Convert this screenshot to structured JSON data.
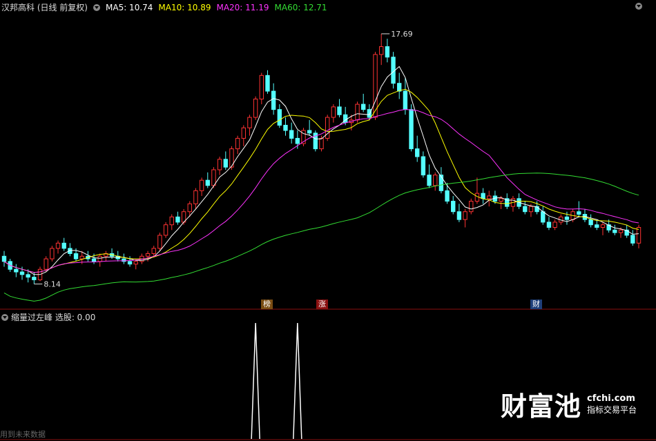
{
  "header": {
    "stock": "汉邦高科 (日线 前复权)",
    "ma5": "MA5: 10.74",
    "ma10": "MA10: 10.89",
    "ma20": "MA20: 11.19",
    "ma60": "MA60: 12.71",
    "colors": {
      "ma5": "#ffffff",
      "ma10": "#ffff00",
      "ma20": "#ff33ff",
      "ma60": "#33dd33",
      "up": "#ff3333",
      "down": "#54ffff"
    }
  },
  "sub_panel": {
    "title": "缩量过左峰 选股: 0.00"
  },
  "tags": [
    "榜",
    "涨",
    "财"
  ],
  "watermark": {
    "brand": "财富池",
    "url": "cfchi.com",
    "slogan": "指标交易平台"
  },
  "footer": "用到未来数据",
  "chart_data": {
    "type": "candlestick",
    "high_label": "17.69",
    "low_label": "8.14",
    "candles": [
      [
        9.2,
        9.4,
        8.8,
        9.0
      ],
      [
        9.0,
        9.1,
        8.6,
        8.7
      ],
      [
        8.7,
        8.9,
        8.4,
        8.6
      ],
      [
        8.6,
        8.8,
        8.3,
        8.5
      ],
      [
        8.5,
        8.7,
        8.2,
        8.4
      ],
      [
        8.4,
        8.6,
        8.14,
        8.3
      ],
      [
        8.3,
        8.8,
        8.25,
        8.7
      ],
      [
        8.7,
        9.2,
        8.6,
        9.1
      ],
      [
        9.1,
        9.6,
        9.0,
        9.5
      ],
      [
        9.5,
        9.8,
        9.3,
        9.7
      ],
      [
        9.7,
        9.9,
        9.4,
        9.5
      ],
      [
        9.5,
        9.7,
        9.2,
        9.3
      ],
      [
        9.3,
        9.5,
        9.0,
        9.1
      ],
      [
        9.1,
        9.4,
        8.9,
        9.2
      ],
      [
        9.2,
        9.4,
        9.0,
        9.1
      ],
      [
        9.1,
        9.3,
        8.9,
        9.0
      ],
      [
        9.0,
        9.3,
        8.8,
        9.2
      ],
      [
        9.2,
        9.4,
        9.0,
        9.3
      ],
      [
        9.3,
        9.5,
        9.1,
        9.2
      ],
      [
        9.2,
        9.4,
        9.0,
        9.1
      ],
      [
        9.1,
        9.3,
        8.9,
        9.0
      ],
      [
        9.0,
        9.2,
        8.8,
        8.9
      ],
      [
        8.9,
        9.1,
        8.7,
        9.0
      ],
      [
        9.0,
        9.3,
        8.9,
        9.2
      ],
      [
        9.2,
        9.4,
        9.0,
        9.3
      ],
      [
        9.3,
        9.6,
        9.2,
        9.5
      ],
      [
        9.5,
        10.1,
        9.4,
        10.0
      ],
      [
        10.0,
        10.5,
        9.9,
        10.4
      ],
      [
        10.4,
        10.8,
        10.2,
        10.7
      ],
      [
        10.7,
        10.9,
        10.4,
        10.5
      ],
      [
        10.5,
        11.0,
        10.4,
        10.9
      ],
      [
        10.9,
        11.3,
        10.7,
        11.2
      ],
      [
        11.2,
        11.8,
        11.0,
        11.7
      ],
      [
        11.7,
        12.2,
        11.5,
        12.1
      ],
      [
        12.1,
        12.4,
        11.8,
        11.9
      ],
      [
        11.9,
        12.6,
        11.8,
        12.5
      ],
      [
        12.5,
        13.0,
        12.3,
        12.9
      ],
      [
        12.9,
        13.2,
        12.5,
        12.6
      ],
      [
        12.6,
        13.4,
        12.5,
        13.3
      ],
      [
        13.3,
        13.8,
        13.1,
        13.7
      ],
      [
        13.7,
        14.2,
        13.4,
        14.1
      ],
      [
        14.1,
        14.6,
        13.8,
        14.5
      ],
      [
        14.5,
        15.3,
        14.4,
        15.2
      ],
      [
        15.2,
        16.2,
        15.0,
        16.1
      ],
      [
        16.1,
        16.3,
        15.4,
        15.5
      ],
      [
        15.5,
        15.8,
        14.6,
        14.8
      ],
      [
        14.8,
        15.0,
        14.1,
        14.2
      ],
      [
        14.2,
        14.5,
        13.8,
        14.0
      ],
      [
        14.0,
        14.3,
        13.5,
        13.7
      ],
      [
        13.7,
        14.0,
        13.3,
        13.5
      ],
      [
        13.5,
        14.1,
        13.4,
        14.0
      ],
      [
        14.0,
        14.4,
        13.8,
        13.9
      ],
      [
        13.9,
        14.0,
        13.2,
        13.3
      ],
      [
        13.3,
        13.8,
        13.2,
        13.7
      ],
      [
        13.7,
        14.6,
        13.6,
        14.5
      ],
      [
        14.5,
        15.0,
        14.3,
        14.9
      ],
      [
        14.9,
        15.2,
        14.5,
        14.6
      ],
      [
        14.6,
        14.9,
        14.2,
        14.3
      ],
      [
        14.3,
        14.6,
        14.0,
        14.4
      ],
      [
        14.4,
        15.1,
        14.3,
        15.0
      ],
      [
        15.0,
        15.4,
        14.7,
        14.8
      ],
      [
        14.8,
        15.0,
        14.4,
        14.5
      ],
      [
        14.5,
        17.0,
        14.4,
        16.9
      ],
      [
        16.9,
        17.69,
        16.5,
        17.2
      ],
      [
        17.2,
        17.5,
        16.6,
        16.8
      ],
      [
        16.8,
        17.0,
        15.6,
        15.8
      ],
      [
        15.8,
        16.2,
        15.2,
        15.5
      ],
      [
        15.5,
        16.0,
        14.6,
        14.8
      ],
      [
        14.8,
        15.0,
        13.2,
        13.3
      ],
      [
        13.3,
        13.8,
        12.8,
        13.0
      ],
      [
        13.0,
        13.2,
        12.2,
        12.3
      ],
      [
        12.3,
        12.7,
        11.8,
        11.9
      ],
      [
        11.9,
        12.4,
        11.7,
        12.3
      ],
      [
        12.3,
        12.6,
        11.6,
        11.7
      ],
      [
        11.7,
        12.0,
        11.2,
        11.3
      ],
      [
        11.3,
        11.5,
        10.8,
        10.9
      ],
      [
        10.9,
        11.2,
        10.5,
        10.6
      ],
      [
        10.6,
        11.0,
        10.3,
        10.9
      ],
      [
        10.9,
        11.4,
        10.8,
        11.3
      ],
      [
        11.3,
        12.2,
        11.2,
        11.6
      ],
      [
        11.6,
        11.8,
        11.2,
        11.4
      ],
      [
        11.4,
        11.7,
        11.1,
        11.5
      ],
      [
        11.5,
        11.7,
        11.2,
        11.3
      ],
      [
        11.3,
        11.5,
        11.0,
        11.4
      ],
      [
        11.4,
        11.6,
        11.0,
        11.1
      ],
      [
        11.1,
        11.5,
        10.9,
        11.4
      ],
      [
        11.4,
        11.6,
        11.0,
        11.1
      ],
      [
        11.1,
        11.3,
        10.8,
        10.9
      ],
      [
        10.9,
        11.2,
        10.7,
        11.1
      ],
      [
        11.1,
        11.3,
        10.8,
        10.9
      ],
      [
        10.9,
        11.1,
        10.4,
        10.5
      ],
      [
        10.5,
        10.7,
        10.2,
        10.3
      ],
      [
        10.3,
        10.6,
        10.2,
        10.5
      ],
      [
        10.5,
        10.8,
        10.4,
        10.7
      ],
      [
        10.7,
        10.9,
        10.4,
        10.6
      ],
      [
        10.6,
        11.0,
        10.5,
        10.9
      ],
      [
        10.9,
        11.3,
        10.7,
        10.8
      ],
      [
        10.8,
        11.0,
        10.5,
        10.6
      ],
      [
        10.6,
        10.8,
        10.3,
        10.4
      ],
      [
        10.4,
        10.6,
        10.2,
        10.3
      ],
      [
        10.3,
        10.5,
        10.0,
        10.4
      ],
      [
        10.4,
        10.6,
        10.1,
        10.2
      ],
      [
        10.2,
        10.4,
        10.0,
        10.1
      ],
      [
        10.1,
        10.3,
        9.9,
        10.2
      ],
      [
        10.2,
        10.4,
        9.9,
        10.0
      ],
      [
        10.0,
        10.2,
        9.6,
        9.7
      ],
      [
        9.7,
        10.4,
        9.5,
        10.3
      ]
    ],
    "ma_series": [
      {
        "name": "MA5",
        "color": "#ffffff",
        "period": 5
      },
      {
        "name": "MA10",
        "color": "#ffff00",
        "period": 10
      },
      {
        "name": "MA20",
        "color": "#ff33ff",
        "period": 20
      },
      {
        "name": "MA60",
        "color": "#33dd33",
        "period": 60
      }
    ],
    "signal_spikes": [
      42,
      49
    ],
    "ylim": [
      7.6,
      18.4
    ]
  }
}
